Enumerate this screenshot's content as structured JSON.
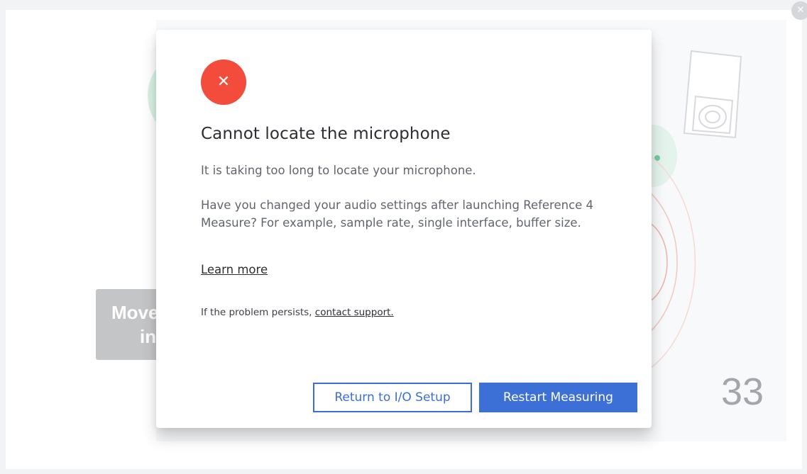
{
  "background": {
    "move_card_line1": "Move",
    "move_card_line2": "in",
    "countdown": "33"
  },
  "dialog": {
    "title": "Cannot locate the microphone",
    "message1": "It is taking too long to locate your microphone.",
    "message2": "Have you changed your audio settings after launching Reference 4 Measure? For example, sample rate, single interface, buffer size.",
    "learn_more": "Learn more",
    "support_prefix": "If the problem persists, ",
    "support_link": "contact support.",
    "secondary_button": "Return to I/O Setup",
    "primary_button": "Restart Measuring"
  },
  "icons": {
    "error": "close-icon",
    "corner": "close-icon",
    "speaker": "speaker-icon"
  },
  "colors": {
    "error": "#f34c3c",
    "accent": "#3d70d7"
  }
}
